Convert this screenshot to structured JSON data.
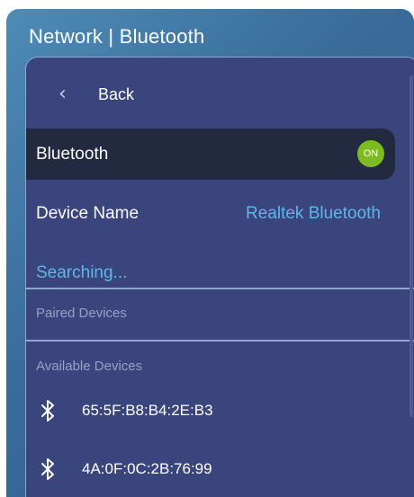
{
  "window": {
    "title": "Network | Bluetooth"
  },
  "nav": {
    "back_icon": "chevron-left-icon",
    "back_label": "Back"
  },
  "bluetooth": {
    "label": "Bluetooth",
    "toggle_state": "ON",
    "toggle_color": "#7dbb20"
  },
  "device_name": {
    "label": "Device Name",
    "value": "Realtek Bluetooth"
  },
  "status": {
    "text": "Searching..."
  },
  "sections": {
    "paired": "Paired Devices",
    "available": "Available Devices"
  },
  "devices": [
    {
      "icon": "bluetooth-icon",
      "address": "65:5F:B8:B4:2E:B3"
    },
    {
      "icon": "bluetooth-icon",
      "address": "4A:0F:0C:2B:76:99"
    }
  ],
  "colors": {
    "accent": "#5fb6e8",
    "panel": "#39457c",
    "selected_row": "#23293f"
  }
}
